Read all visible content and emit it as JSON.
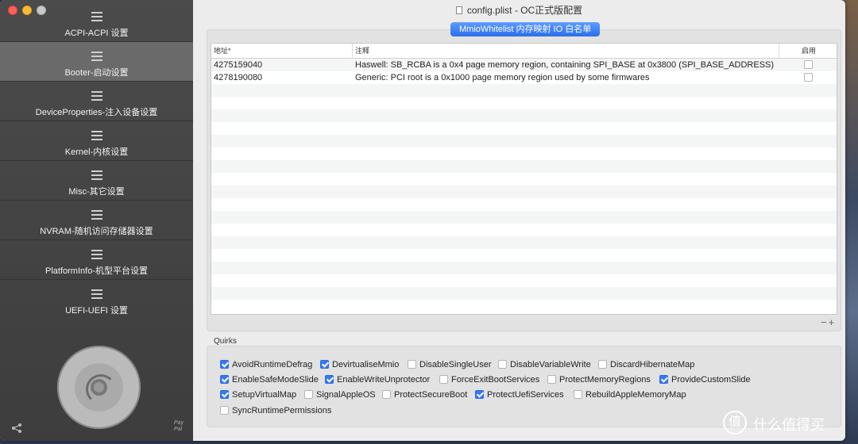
{
  "window": {
    "title": "config.plist - OC正式版配置"
  },
  "sidebar": {
    "items": [
      {
        "label": "ACPI-ACPI 设置",
        "active": false
      },
      {
        "label": "Booter-启动设置",
        "active": true
      },
      {
        "label": "DeviceProperties-注入设备设置",
        "active": false
      },
      {
        "label": "Kernel-内核设置",
        "active": false
      },
      {
        "label": "Misc-其它设置",
        "active": false
      },
      {
        "label": "NVRAM-随机访问存储器设置",
        "active": false
      },
      {
        "label": "PlatformInfo-机型平台设置",
        "active": false
      },
      {
        "label": "UEFI-UEFI 设置",
        "active": false
      }
    ],
    "paypal_text": "Pay Pal"
  },
  "main": {
    "active_tab": "MmioWhitelist 内存映射 IO 白名单",
    "table": {
      "headers": {
        "address": "地址*",
        "comment": "注释",
        "enabled": "启用"
      },
      "rows": [
        {
          "address": "4275159040",
          "comment": "Haswell: SB_RCBA is a 0x4 page memory region, containing SPI_BASE at 0x3800 (SPI_BASE_ADDRESS)",
          "enabled": false
        },
        {
          "address": "4278190080",
          "comment": "Generic: PCI root is a 0x1000 page memory region used by some firmwares",
          "enabled": false
        }
      ]
    },
    "add_remove": "−+",
    "quirks_label": "Quirks",
    "quirks": [
      {
        "label": "AvoidRuntimeDefrag",
        "checked": true
      },
      {
        "label": "DevirtualiseMmio",
        "checked": true
      },
      {
        "label": "DisableSingleUser",
        "checked": false
      },
      {
        "label": "DisableVariableWrite",
        "checked": false
      },
      {
        "label": "DiscardHibernateMap",
        "checked": false
      },
      {
        "label": "EnableSafeModeSlide",
        "checked": true
      },
      {
        "label": "EnableWriteUnprotector",
        "checked": true
      },
      {
        "label": "ForceExitBootServices",
        "checked": false
      },
      {
        "label": "ProtectMemoryRegions",
        "checked": false
      },
      {
        "label": "ProvideCustomSlide",
        "checked": true
      },
      {
        "label": "SetupVirtualMap",
        "checked": true
      },
      {
        "label": "SignalAppleOS",
        "checked": false
      },
      {
        "label": "ProtectSecureBoot",
        "checked": false
      },
      {
        "label": "ProtectUefiServices",
        "checked": true
      },
      {
        "label": "RebuildAppleMemoryMap",
        "checked": false
      },
      {
        "label": "SyncRuntimePermissions",
        "checked": false
      }
    ]
  },
  "watermark": {
    "icon_text": "值",
    "text": "什么值得买"
  },
  "colors": {
    "accent": "#3478f6",
    "sidebar_bg": "#3d3d3d",
    "sidebar_active": "#6a6a6a"
  }
}
